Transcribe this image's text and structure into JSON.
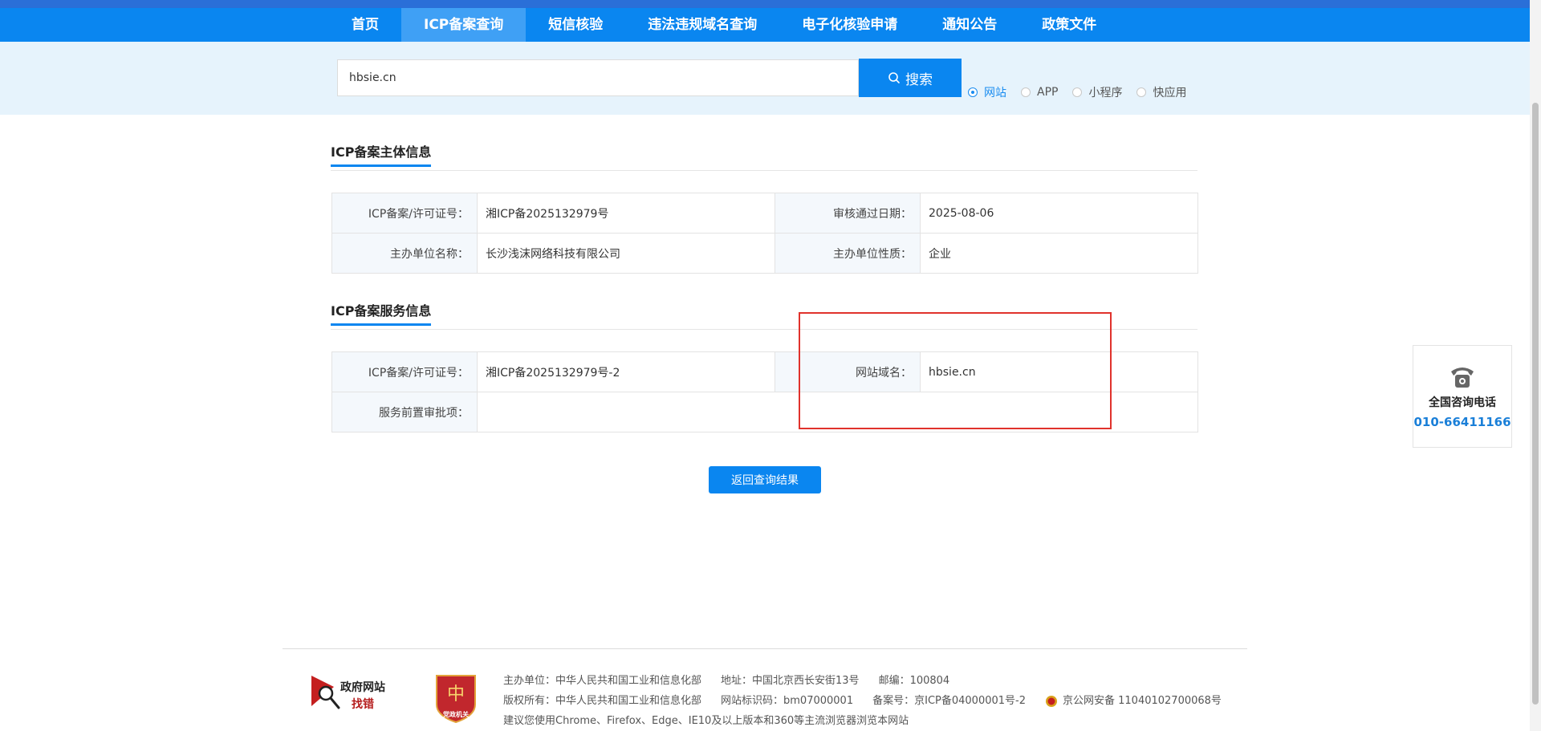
{
  "nav": {
    "items": [
      {
        "label": "首页"
      },
      {
        "label": "ICP备案查询"
      },
      {
        "label": "短信核验"
      },
      {
        "label": "违法违规域名查询"
      },
      {
        "label": "电子化核验申请"
      },
      {
        "label": "通知公告"
      },
      {
        "label": "政策文件"
      }
    ],
    "active_index": 1
  },
  "search": {
    "value": "hbsie.cn",
    "button_label": "搜索",
    "types": [
      {
        "label": "网站",
        "checked": true
      },
      {
        "label": "APP",
        "checked": false
      },
      {
        "label": "小程序",
        "checked": false
      },
      {
        "label": "快应用",
        "checked": false
      }
    ]
  },
  "subject_info": {
    "title": "ICP备案主体信息",
    "rows": [
      {
        "k1": "ICP备案/许可证号：",
        "v1": "湘ICP备2025132979号",
        "k2": "审核通过日期：",
        "v2": "2025-08-06"
      },
      {
        "k1": "主办单位名称：",
        "v1": "长沙浅沫网络科技有限公司",
        "k2": "主办单位性质：",
        "v2": "企业"
      }
    ]
  },
  "service_info": {
    "title": "ICP备案服务信息",
    "rows": [
      {
        "k1": "ICP备案/许可证号：",
        "v1": "湘ICP备2025132979号-2",
        "k2": "网站域名：",
        "v2": "hbsie.cn"
      }
    ],
    "approval_label": "服务前置审批项：",
    "approval_value": ""
  },
  "back_button_label": "返回查询结果",
  "hotline": {
    "title": "全国咨询电话",
    "number": "010-66411166"
  },
  "footer": {
    "gov_logo_line1": "政府网站",
    "gov_logo_line2": "找错",
    "party_logo_label": "党政机关",
    "row1": [
      "主办单位：中华人民共和国工业和信息化部",
      "地址：中国北京西长安街13号",
      "邮编：100804"
    ],
    "row2": [
      "版权所有：中华人民共和国工业和信息化部",
      "网站标识码：bm07000001",
      "备案号：京ICP备04000001号-2"
    ],
    "police_record": "京公网安备 11040102700068号",
    "row3": "建议您使用Chrome、Firefox、Edge、IE10及以上版本和360等主流浏览器浏览本网站"
  },
  "colors": {
    "nav_bg": "#0a86f0",
    "nav_active": "#3fa0f5",
    "search_bg": "#e6f3fc",
    "highlight": "#e0322c"
  }
}
